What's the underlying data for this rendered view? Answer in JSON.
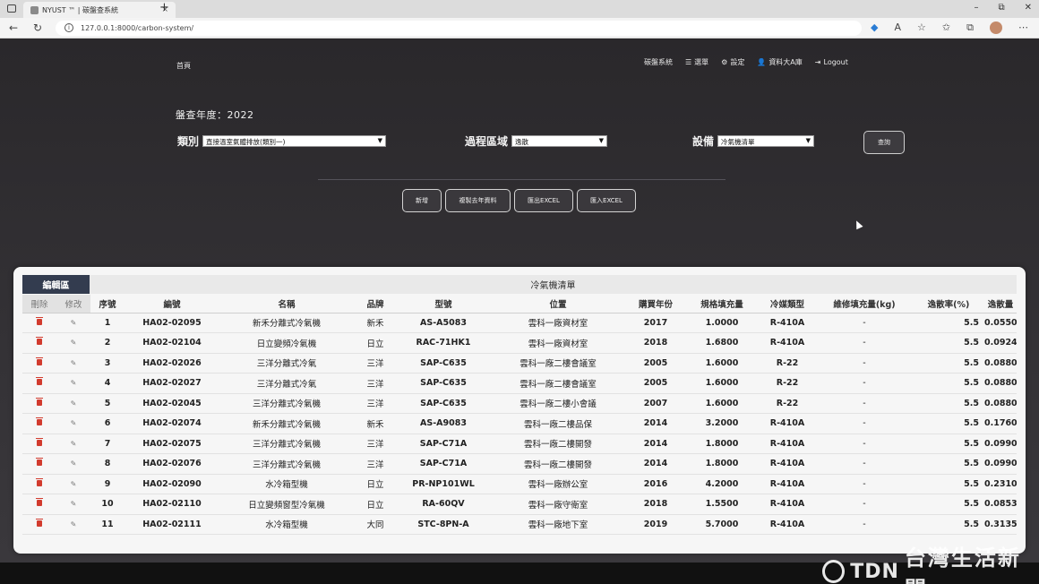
{
  "browser": {
    "tab_title": "NYUST ™ | 碳盤查系統",
    "tab_close": "×",
    "new_tab": "+",
    "url": "127.0.0.1:8000/carbon-system/",
    "win_minimize": "–",
    "win_restore": "⧉",
    "win_close": "✕"
  },
  "nav": {
    "brand": "首頁",
    "items": [
      "碳盤系統",
      "選單",
      "設定",
      "資料大A庫",
      "Logout"
    ]
  },
  "filters": {
    "year_label": "盤查年度：",
    "year_value": "2022",
    "category_label": "類別",
    "category_value": "直接溫室氣體排放(類別一)",
    "area_label": "過程區域",
    "area_value": "逸散",
    "equipment_label": "設備",
    "equipment_value": "冷氣機清單",
    "query_label": "查詢"
  },
  "actions": {
    "add": "新增",
    "copy_last_year": "複製去年資料",
    "export_excel": "匯出EXCEL",
    "import_excel": "匯入EXCEL"
  },
  "card": {
    "edit_tab": "編輯區",
    "title": "冷氣機清單"
  },
  "table": {
    "headers": [
      "刪除",
      "修改",
      "序號",
      "編號",
      "名稱",
      "品牌",
      "型號",
      "位置",
      "購買年份",
      "規格填充量",
      "冷媒類型",
      "維修填充量(kg)",
      "逸散率(%)",
      "逸散量"
    ],
    "rows": [
      {
        "seq": "1",
        "code": "HA02-02095",
        "name": "新禾分離式冷氣機",
        "brand": "新禾",
        "model": "AS-A5083",
        "location": "雲科一廠資材室",
        "year": "2017",
        "spec": "1.0000",
        "refrigerant": "R-410A",
        "repair": "-",
        "rate": "5.5",
        "amount": "0.0550"
      },
      {
        "seq": "2",
        "code": "HA02-02104",
        "name": "日立變頻冷氣機",
        "brand": "日立",
        "model": "RAC-71HK1",
        "location": "雲科一廠資材室",
        "year": "2018",
        "spec": "1.6800",
        "refrigerant": "R-410A",
        "repair": "-",
        "rate": "5.5",
        "amount": "0.0924"
      },
      {
        "seq": "3",
        "code": "HA02-02026",
        "name": "三洋分離式冷氣",
        "brand": "三洋",
        "model": "SAP-C635",
        "location": "雲科一廠二樓會議室",
        "year": "2005",
        "spec": "1.6000",
        "refrigerant": "R-22",
        "repair": "-",
        "rate": "5.5",
        "amount": "0.0880"
      },
      {
        "seq": "4",
        "code": "HA02-02027",
        "name": "三洋分離式冷氣",
        "brand": "三洋",
        "model": "SAP-C635",
        "location": "雲科一廠二樓會議室",
        "year": "2005",
        "spec": "1.6000",
        "refrigerant": "R-22",
        "repair": "-",
        "rate": "5.5",
        "amount": "0.0880"
      },
      {
        "seq": "5",
        "code": "HA02-02045",
        "name": "三洋分離式冷氣機",
        "brand": "三洋",
        "model": "SAP-C635",
        "location": "雲科一廠二樓小會議",
        "year": "2007",
        "spec": "1.6000",
        "refrigerant": "R-22",
        "repair": "-",
        "rate": "5.5",
        "amount": "0.0880"
      },
      {
        "seq": "6",
        "code": "HA02-02074",
        "name": "新禾分離式冷氣機",
        "brand": "新禾",
        "model": "AS-A9083",
        "location": "雲科一廠二樓品保",
        "year": "2014",
        "spec": "3.2000",
        "refrigerant": "R-410A",
        "repair": "-",
        "rate": "5.5",
        "amount": "0.1760"
      },
      {
        "seq": "7",
        "code": "HA02-02075",
        "name": "三洋分離式冷氣機",
        "brand": "三洋",
        "model": "SAP-C71A",
        "location": "雲科一廠二樓開發",
        "year": "2014",
        "spec": "1.8000",
        "refrigerant": "R-410A",
        "repair": "-",
        "rate": "5.5",
        "amount": "0.0990"
      },
      {
        "seq": "8",
        "code": "HA02-02076",
        "name": "三洋分離式冷氣機",
        "brand": "三洋",
        "model": "SAP-C71A",
        "location": "雲科一廠二樓開發",
        "year": "2014",
        "spec": "1.8000",
        "refrigerant": "R-410A",
        "repair": "-",
        "rate": "5.5",
        "amount": "0.0990"
      },
      {
        "seq": "9",
        "code": "HA02-02090",
        "name": "水冷箱型機",
        "brand": "日立",
        "model": "PR-NP101WL",
        "location": "雲科一廠辦公室",
        "year": "2016",
        "spec": "4.2000",
        "refrigerant": "R-410A",
        "repair": "-",
        "rate": "5.5",
        "amount": "0.2310"
      },
      {
        "seq": "10",
        "code": "HA02-02110",
        "name": "日立變頻窗型冷氣機",
        "brand": "日立",
        "model": "RA-60QV",
        "location": "雲科一廠守衛室",
        "year": "2018",
        "spec": "1.5500",
        "refrigerant": "R-410A",
        "repair": "-",
        "rate": "5.5",
        "amount": "0.0853"
      },
      {
        "seq": "11",
        "code": "HA02-02111",
        "name": "水冷箱型機",
        "brand": "大同",
        "model": "STC-8PN-A",
        "location": "雲科一廠地下室",
        "year": "2019",
        "spec": "5.7000",
        "refrigerant": "R-410A",
        "repair": "-",
        "rate": "5.5",
        "amount": "0.3135"
      }
    ]
  },
  "watermark": {
    "logo": "TDN",
    "name": "台灣生活新聞"
  }
}
